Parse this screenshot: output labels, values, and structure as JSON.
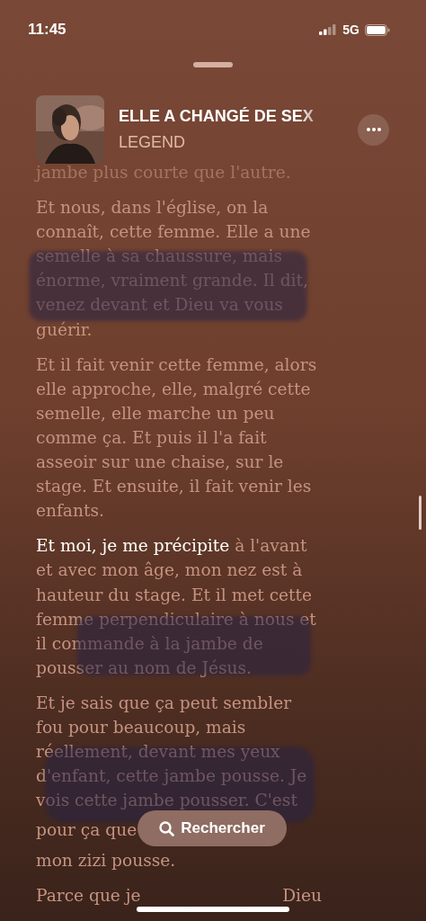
{
  "status_bar": {
    "time": "11:45",
    "network": "5G"
  },
  "episode": {
    "title": "ELLE A CHANGÉ DE SEX",
    "show": "LEGEND"
  },
  "transcript": [
    {
      "kind": "flow",
      "segments": [
        {
          "text": "jambe plus courte que l'autre.",
          "current": false
        }
      ]
    },
    {
      "kind": "flow",
      "segments": [
        {
          "text": "Et nous, dans l'église, on la connaît, cette femme. Elle a une semelle à sa chaussure, mais énorme, vraiment grande. Il dit, venez devant et Dieu va vous guérir.",
          "current": false
        }
      ]
    },
    {
      "kind": "flow",
      "segments": [
        {
          "text": "Et il fait venir cette femme, alors elle approche, elle, malgré cette semelle, elle marche un peu comme ça. Et puis il l'a fait asseoir sur une chaise, sur le stage. Et ensuite, il fait venir les enfants.",
          "current": false
        }
      ]
    },
    {
      "kind": "flow",
      "segments": [
        {
          "text": "Et moi, je me précipite",
          "current": true
        },
        {
          "text": " à l'avant et avec mon âge, mon nez est à hauteur du stage. Et il met cette femme perpendiculaire à nous et il commande à la jambe de pousser au nom de Jésus.",
          "current": false
        }
      ]
    },
    {
      "kind": "blocks",
      "pieces": [
        "Et je sais que ça peut sembler fou pour beaucoup, mais réellement, devant mes yeux d'enfant, cette jambe pousse. Je vois cette jambe pousser. C'est",
        "pour ça que",
        "mon zizi pousse."
      ]
    },
    {
      "kind": "row",
      "pieces": [
        "Parce que je",
        "Dieu"
      ]
    }
  ],
  "search_button": {
    "label": "Rechercher"
  }
}
